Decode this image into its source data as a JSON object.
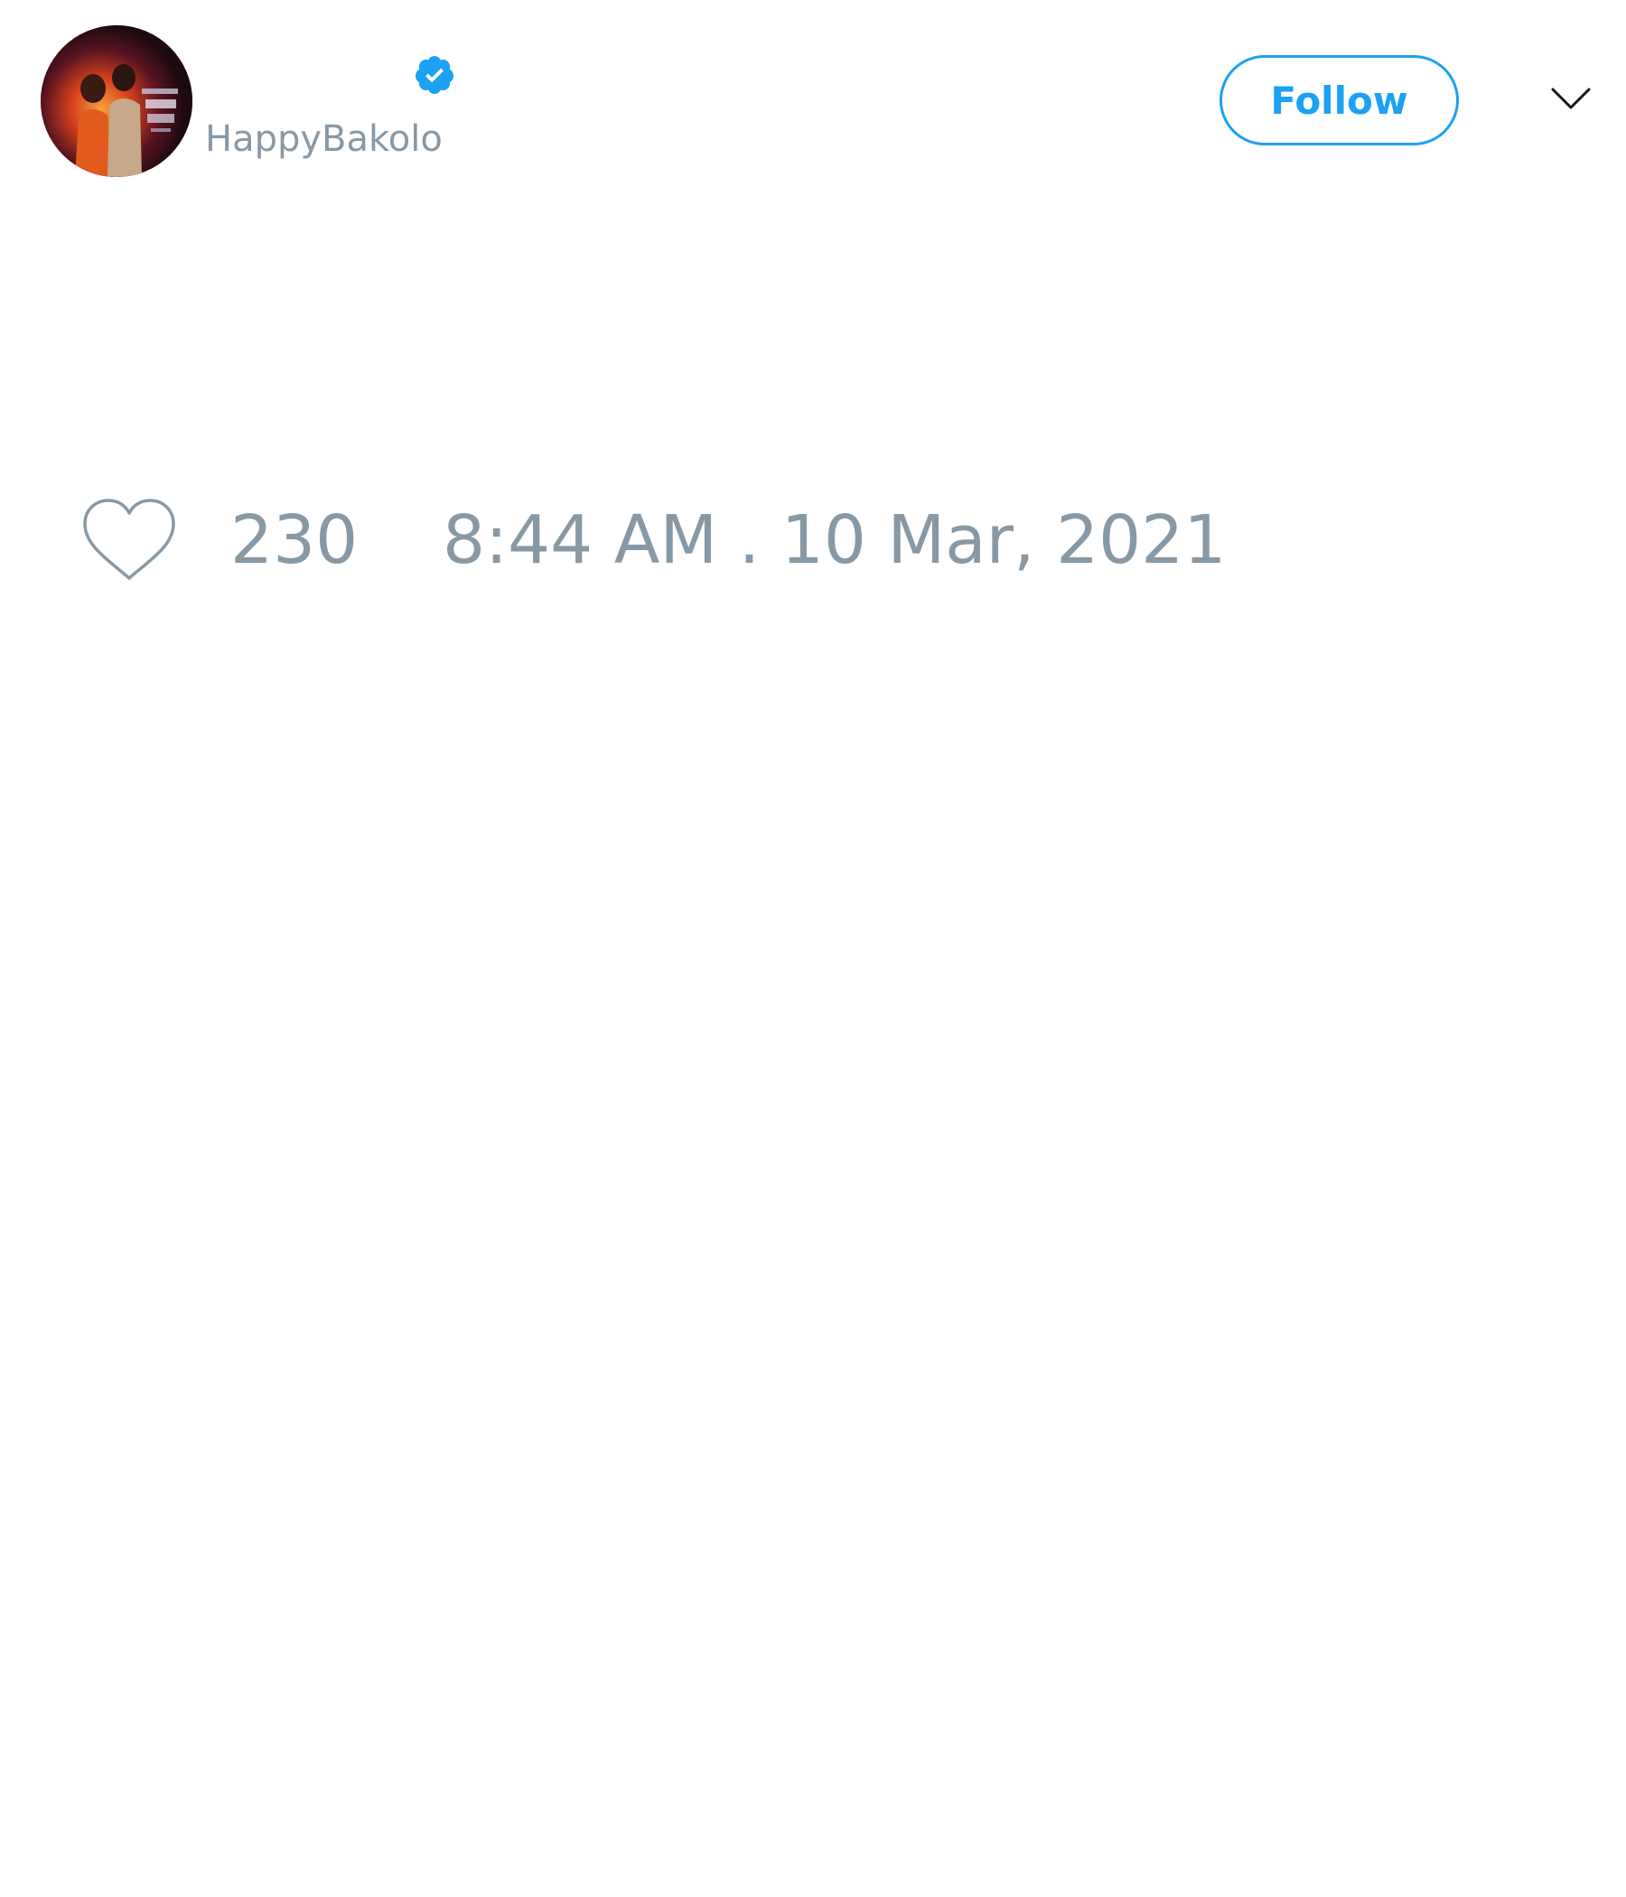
{
  "header": {
    "display_name": "",
    "handle": "HappyBakolo",
    "verified": true,
    "follow_label": "Follow",
    "avatar_icon": "profile-photo",
    "menu_icon": "chevron-down-icon"
  },
  "footer": {
    "like_icon": "heart-icon",
    "like_count": "230",
    "timestamp": "8:44 AM . 10 Mar, 2021"
  },
  "colors": {
    "accent": "#1da1f2",
    "muted_text": "#8899a6",
    "background": "#ffffff"
  }
}
